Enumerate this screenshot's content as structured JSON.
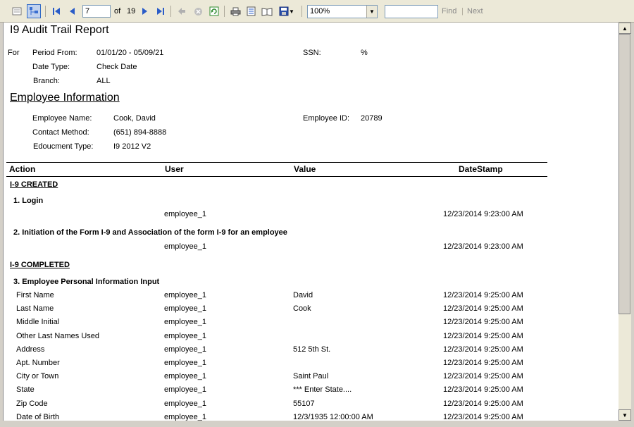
{
  "toolbar": {
    "page_value": "7",
    "of_label": "of",
    "total_pages": "19",
    "zoom_value": "100%",
    "find_label": "Find",
    "next_label": "Next"
  },
  "report": {
    "title": "I9 Audit Trail Report",
    "for_label": "For",
    "period_label": "Period From:",
    "period_value": "01/01/20 - 05/09/21",
    "ssn_label": "SSN:",
    "ssn_value": "%",
    "date_type_label": "Date Type:",
    "date_type_value": "Check Date",
    "branch_label": "Branch:",
    "branch_value": "ALL",
    "employee_section_title": "Employee Information",
    "employee_name_label": "Employee Name:",
    "employee_name_value": "Cook, David",
    "employee_id_label": "Employee ID:",
    "employee_id_value": "20789",
    "contact_label": "Contact Method:",
    "contact_value": "(651) 894-8888",
    "edoc_label": "Edoucment Type:",
    "edoc_value": "I9 2012 V2",
    "columns": [
      "Action",
      "User",
      "Value",
      "DateStamp"
    ],
    "section1": "I-9 CREATED",
    "group1": "1. Login",
    "group1_user": "employee_1",
    "group1_date": "12/23/2014 9:23:00 AM",
    "group2": "2. Initiation of the Form I-9 and Association of the form I-9 for an employee",
    "group2_user": "employee_1",
    "group2_date": "12/23/2014 9:23:00 AM",
    "section2": "I-9 COMPLETED",
    "group3": "3. Employee Personal Information Input",
    "rows": [
      {
        "action": "First Name",
        "user": "employee_1",
        "value": "David",
        "date": "12/23/2014 9:25:00 AM"
      },
      {
        "action": "Last Name",
        "user": "employee_1",
        "value": "Cook",
        "date": "12/23/2014 9:25:00 AM"
      },
      {
        "action": "Middle Initial",
        "user": "employee_1",
        "value": "",
        "date": "12/23/2014 9:25:00 AM"
      },
      {
        "action": "Other Last Names Used",
        "user": "employee_1",
        "value": "",
        "date": "12/23/2014 9:25:00 AM"
      },
      {
        "action": "Address",
        "user": "employee_1",
        "value": "512 5th St.",
        "date": "12/23/2014 9:25:00 AM"
      },
      {
        "action": "Apt. Number",
        "user": "employee_1",
        "value": "",
        "date": "12/23/2014 9:25:00 AM"
      },
      {
        "action": "City or Town",
        "user": "employee_1",
        "value": "Saint Paul",
        "date": "12/23/2014 9:25:00 AM"
      },
      {
        "action": "State",
        "user": "employee_1",
        "value": "*** Enter State....",
        "date": "12/23/2014 9:25:00 AM"
      },
      {
        "action": "Zip Code",
        "user": "employee_1",
        "value": "55107",
        "date": "12/23/2014 9:25:00 AM"
      },
      {
        "action": "Date of Birth",
        "user": "employee_1",
        "value": "12/3/1935 12:00:00 AM",
        "date": "12/23/2014 9:25:00 AM"
      }
    ]
  },
  "icons": [
    "toggle-params-icon",
    "document-map-icon",
    "first-page-icon",
    "prev-page-icon",
    "next-page-icon",
    "last-page-icon",
    "back-icon",
    "stop-icon",
    "refresh-icon",
    "print-icon",
    "print-layout-icon",
    "page-setup-icon",
    "export-icon"
  ]
}
